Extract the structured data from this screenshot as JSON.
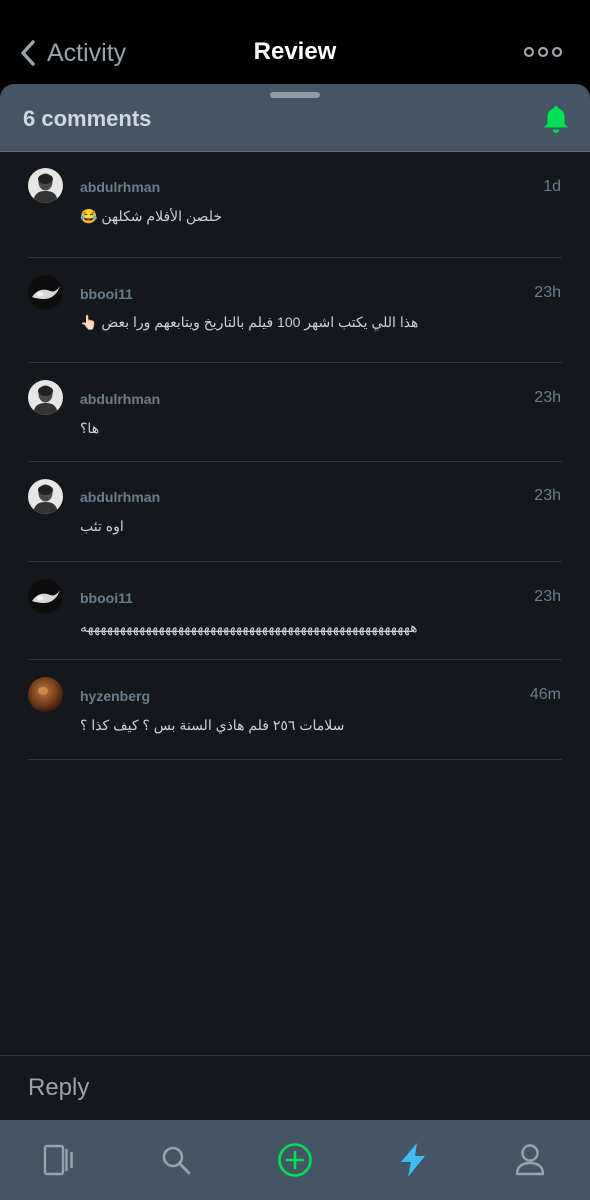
{
  "nav": {
    "back_label": "Activity",
    "title": "Review",
    "more_icon": "more-horizontal-icon"
  },
  "sheet": {
    "count_label": "6 comments",
    "bell_icon": "bell-icon",
    "bell_color": "#00e054"
  },
  "comments": [
    {
      "username": "abdulrhman",
      "time": "1d",
      "text": "خلصن الأفلام شكلهن 😂"
    },
    {
      "username": "bbooi11",
      "time": "23h",
      "text": "هذا اللي يكتب اشهر 100 فيلم بالتاريخ ويتابعهم ورا بعض 👆🏻"
    },
    {
      "username": "abdulrhman",
      "time": "23h",
      "text": "ها؟"
    },
    {
      "username": "abdulrhman",
      "time": "23h",
      "text": "اوه تئب"
    },
    {
      "username": "bbooi11",
      "time": "23h",
      "text": "هههههههههههههههههههههههههههههههههههههههههههههههههههه"
    },
    {
      "username": "hyzenberg",
      "time": "46m",
      "text": "سلامات ٢٥٦ فلم هاذي السنة بس ؟ كيف كذا ؟"
    }
  ],
  "reply": {
    "placeholder": "Reply"
  },
  "tabs": [
    {
      "name": "films",
      "icon": "film-icon",
      "color": "#9aa3ad"
    },
    {
      "name": "search",
      "icon": "search-icon",
      "color": "#9aa3ad"
    },
    {
      "name": "add",
      "icon": "add-circle-icon",
      "color": "#00e054"
    },
    {
      "name": "activity",
      "icon": "lightning-icon",
      "color": "#40bcf4"
    },
    {
      "name": "profile",
      "icon": "profile-icon",
      "color": "#9aa3ad"
    }
  ]
}
